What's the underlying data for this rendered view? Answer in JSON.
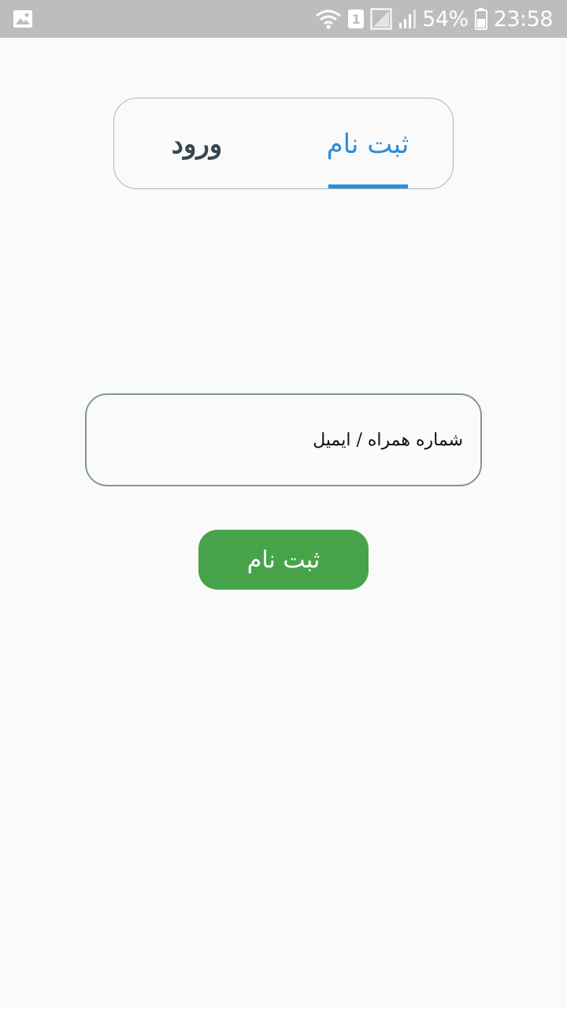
{
  "status_bar": {
    "battery_percent": "54%",
    "time": "23:58",
    "sim_slot": "1",
    "icons": [
      "image-icon",
      "wifi-icon",
      "sim-icon",
      "no-signal-icon",
      "signal-icon",
      "battery-icon"
    ]
  },
  "tabs": {
    "login_label": "ورود",
    "register_label": "ثبت نام",
    "active": "register",
    "active_color": "#2d8ed8"
  },
  "form": {
    "identifier_placeholder": "شماره همراه / ایمیل",
    "identifier_value": ""
  },
  "submit": {
    "label": "ثبت نام",
    "color": "#47a34a"
  }
}
